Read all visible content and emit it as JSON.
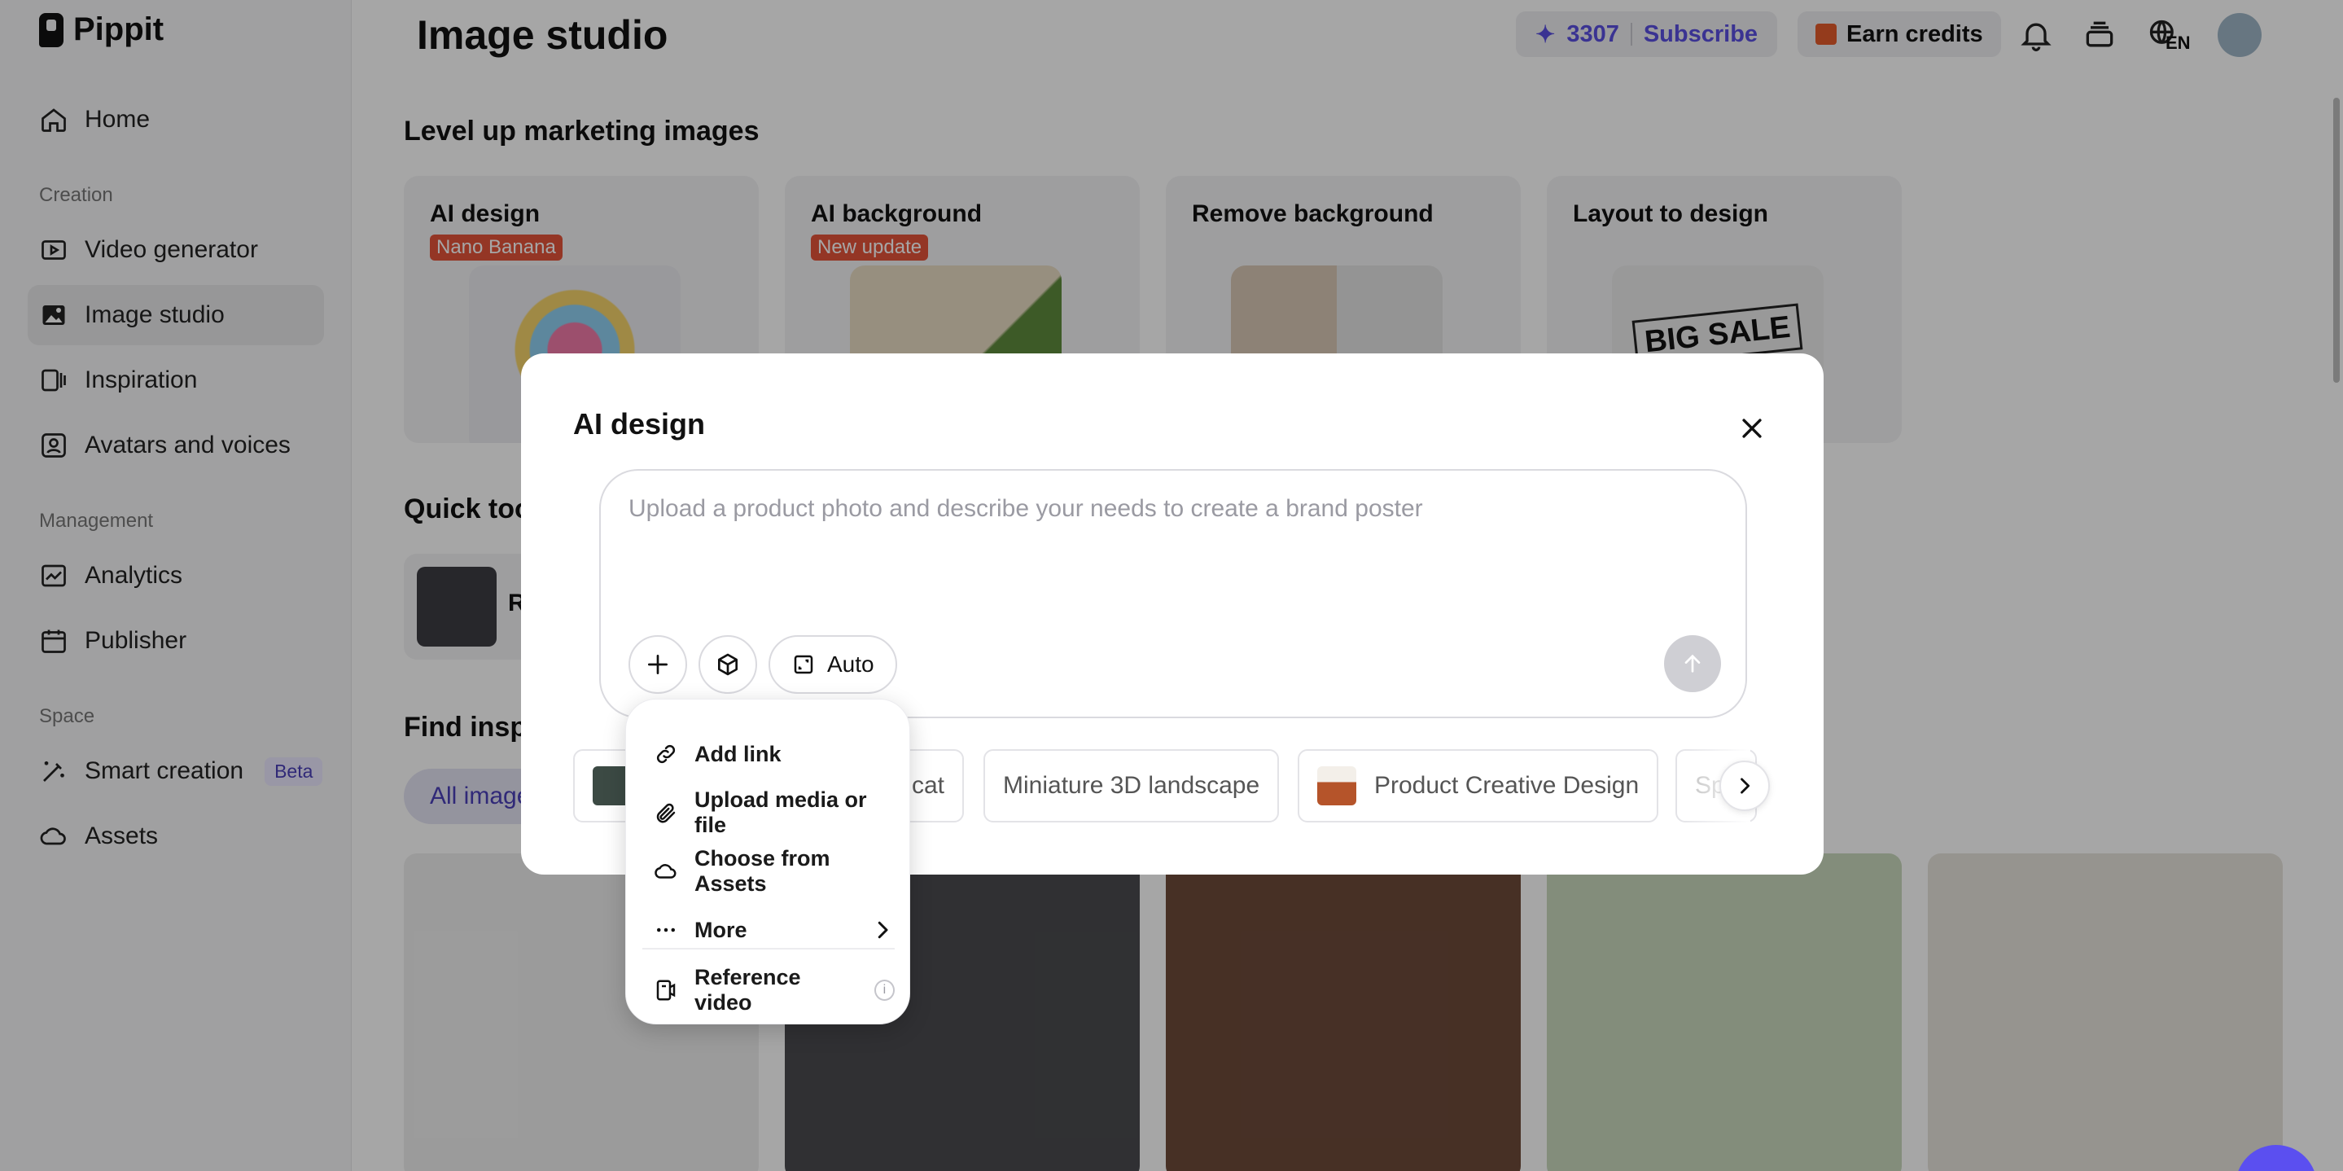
{
  "app": {
    "name": "Pippit"
  },
  "sidebar": {
    "sections": {
      "creation": "Creation",
      "management": "Management",
      "space": "Space"
    },
    "items": [
      {
        "label": "Home",
        "icon": "home-icon"
      },
      {
        "label": "Video generator",
        "icon": "video-icon"
      },
      {
        "label": "Image studio",
        "icon": "image-icon",
        "active": true
      },
      {
        "label": "Inspiration",
        "icon": "inspiration-icon"
      },
      {
        "label": "Avatars and voices",
        "icon": "avatar-icon"
      },
      {
        "label": "Analytics",
        "icon": "analytics-icon"
      },
      {
        "label": "Publisher",
        "icon": "calendar-icon"
      },
      {
        "label": "Smart creation",
        "icon": "wand-icon",
        "badge": "Beta"
      },
      {
        "label": "Assets",
        "icon": "cloud-icon"
      }
    ]
  },
  "header": {
    "title": "Image studio",
    "credits": "3307",
    "subscribe": "Subscribe",
    "earn": "Earn credits",
    "language": "EN"
  },
  "main": {
    "section_title": "Level up marketing images",
    "cards": [
      {
        "title": "AI design",
        "badge": "Nano Banana"
      },
      {
        "title": "AI background",
        "badge": "New update"
      },
      {
        "title": "Remove background",
        "badge": ""
      },
      {
        "title": "Layout to design",
        "badge": "",
        "art_text": "BIG SALE"
      }
    ],
    "quick_tools_title": "Quick tools",
    "quick_tool_item": "R",
    "find_title": "Find inspiration",
    "filter_all": "All images"
  },
  "modal": {
    "title": "AI design",
    "prompt_placeholder": "Upload a product photo and describe your needs to create a brand poster",
    "auto_label": "Auto",
    "suggestions": [
      {
        "label": "cat"
      },
      {
        "label": "Miniature 3D landscape"
      },
      {
        "label": "Product Creative Design"
      },
      {
        "label": "Sp"
      }
    ]
  },
  "menu": {
    "items": [
      {
        "label": "Add link",
        "icon": "link-icon"
      },
      {
        "label": "Upload media or file",
        "icon": "paperclip-icon"
      },
      {
        "label": "Choose from Assets",
        "icon": "cloud-icon"
      },
      {
        "label": "More",
        "icon": "more-icon"
      },
      {
        "label": "Reference video",
        "icon": "reference-video-icon"
      }
    ]
  },
  "colors": {
    "accent": "#5a4fe0",
    "badge_red": "#e3533a",
    "overlay": "rgba(0,0,0,0.35)"
  }
}
